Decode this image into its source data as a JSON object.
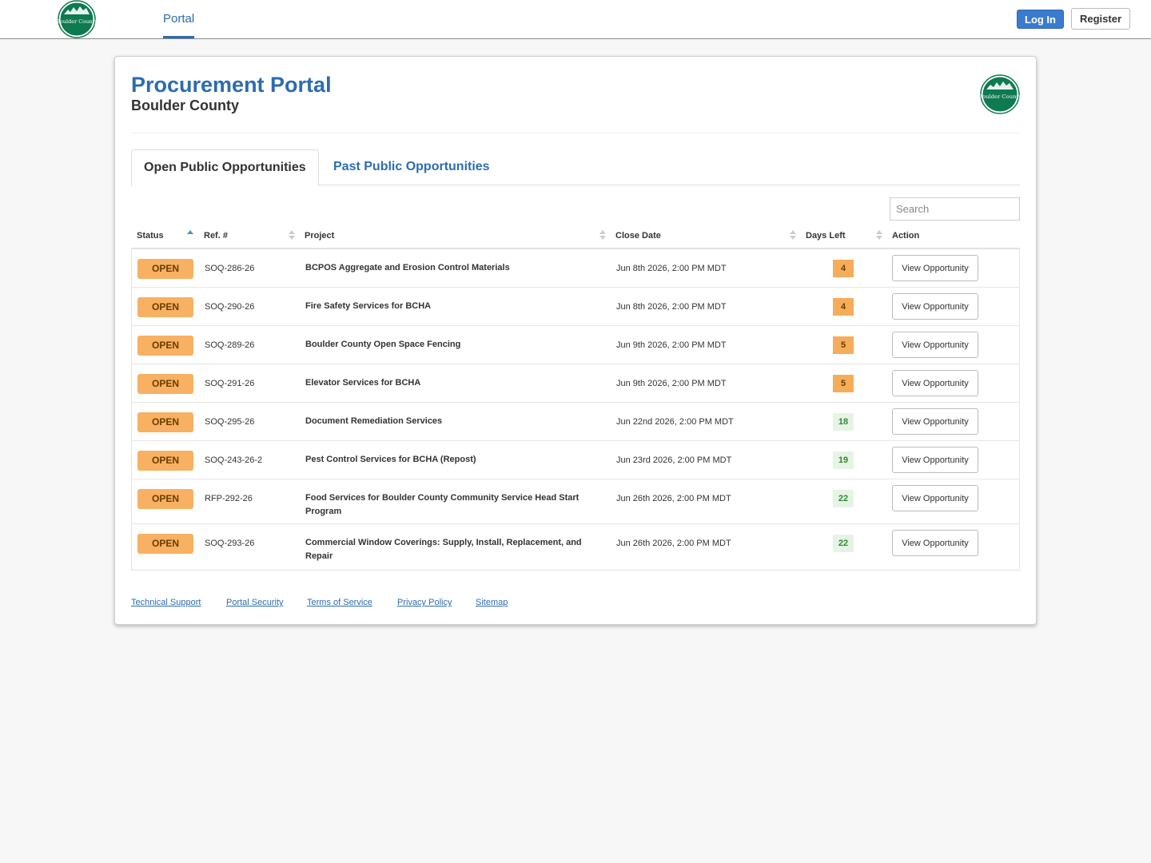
{
  "topnav": {
    "logo_text": "Boulder County",
    "portal_label": "Portal",
    "login_label": "Log In",
    "register_label": "Register"
  },
  "header": {
    "title": "Procurement Portal",
    "subtitle": "Boulder County",
    "logo_text": "Boulder County"
  },
  "tabs": {
    "open": "Open Public Opportunities",
    "past": "Past Public Opportunities"
  },
  "search": {
    "placeholder": "Search"
  },
  "table": {
    "headers": {
      "status": "Status",
      "ref": "Ref. #",
      "project": "Project",
      "close_date": "Close Date",
      "days_left": "Days Left",
      "action": "Action"
    },
    "rows": [
      {
        "status": "OPEN",
        "ref": "SOQ-286-26",
        "project": "BCPOS Aggregate and Erosion Control Materials",
        "close_date": "Jun 8th 2026, 2:00 PM MDT",
        "days_left": "4",
        "days_status": "warn",
        "action": "View Opportunity"
      },
      {
        "status": "OPEN",
        "ref": "SOQ-290-26",
        "project": "Fire Safety Services for BCHA",
        "close_date": "Jun 8th 2026, 2:00 PM MDT",
        "days_left": "4",
        "days_status": "warn",
        "action": "View Opportunity"
      },
      {
        "status": "OPEN",
        "ref": "SOQ-289-26",
        "project": "Boulder County Open Space Fencing",
        "close_date": "Jun 9th 2026, 2:00 PM MDT",
        "days_left": "5",
        "days_status": "warn",
        "action": "View Opportunity"
      },
      {
        "status": "OPEN",
        "ref": "SOQ-291-26",
        "project": "Elevator Services for BCHA",
        "close_date": "Jun 9th 2026, 2:00 PM MDT",
        "days_left": "5",
        "days_status": "warn",
        "action": "View Opportunity"
      },
      {
        "status": "OPEN",
        "ref": "SOQ-295-26",
        "project": "Document Remediation Services",
        "close_date": "Jun 22nd 2026, 2:00 PM MDT",
        "days_left": "18",
        "days_status": "ok",
        "action": "View Opportunity"
      },
      {
        "status": "OPEN",
        "ref": "SOQ-243-26-2",
        "project": "Pest Control Services for BCHA (Repost)",
        "close_date": "Jun 23rd 2026, 2:00 PM MDT",
        "days_left": "19",
        "days_status": "ok",
        "action": "View Opportunity"
      },
      {
        "status": "OPEN",
        "ref": "RFP-292-26",
        "project": "Food Services for Boulder County Community Service Head Start Program",
        "close_date": "Jun 26th 2026, 2:00 PM MDT",
        "days_left": "22",
        "days_status": "ok",
        "action": "View Opportunity"
      },
      {
        "status": "OPEN",
        "ref": "SOQ-293-26",
        "project": "Commercial Window Coverings: Supply, Install, Replacement, and Repair",
        "close_date": "Jun 26th 2026, 2:00 PM MDT",
        "days_left": "22",
        "days_status": "ok",
        "action": "View Opportunity"
      }
    ]
  },
  "footer": {
    "links": [
      "Technical Support",
      "Portal Security",
      "Terms of Service",
      "Privacy Policy",
      "Sitemap"
    ]
  },
  "colors": {
    "brand_blue": "#2c6cb0",
    "login_blue": "#3a7bd0",
    "open_orange": "#f8b062",
    "logo_green": "#0e7a4f",
    "days_ok_green": "#2f8a2f"
  }
}
